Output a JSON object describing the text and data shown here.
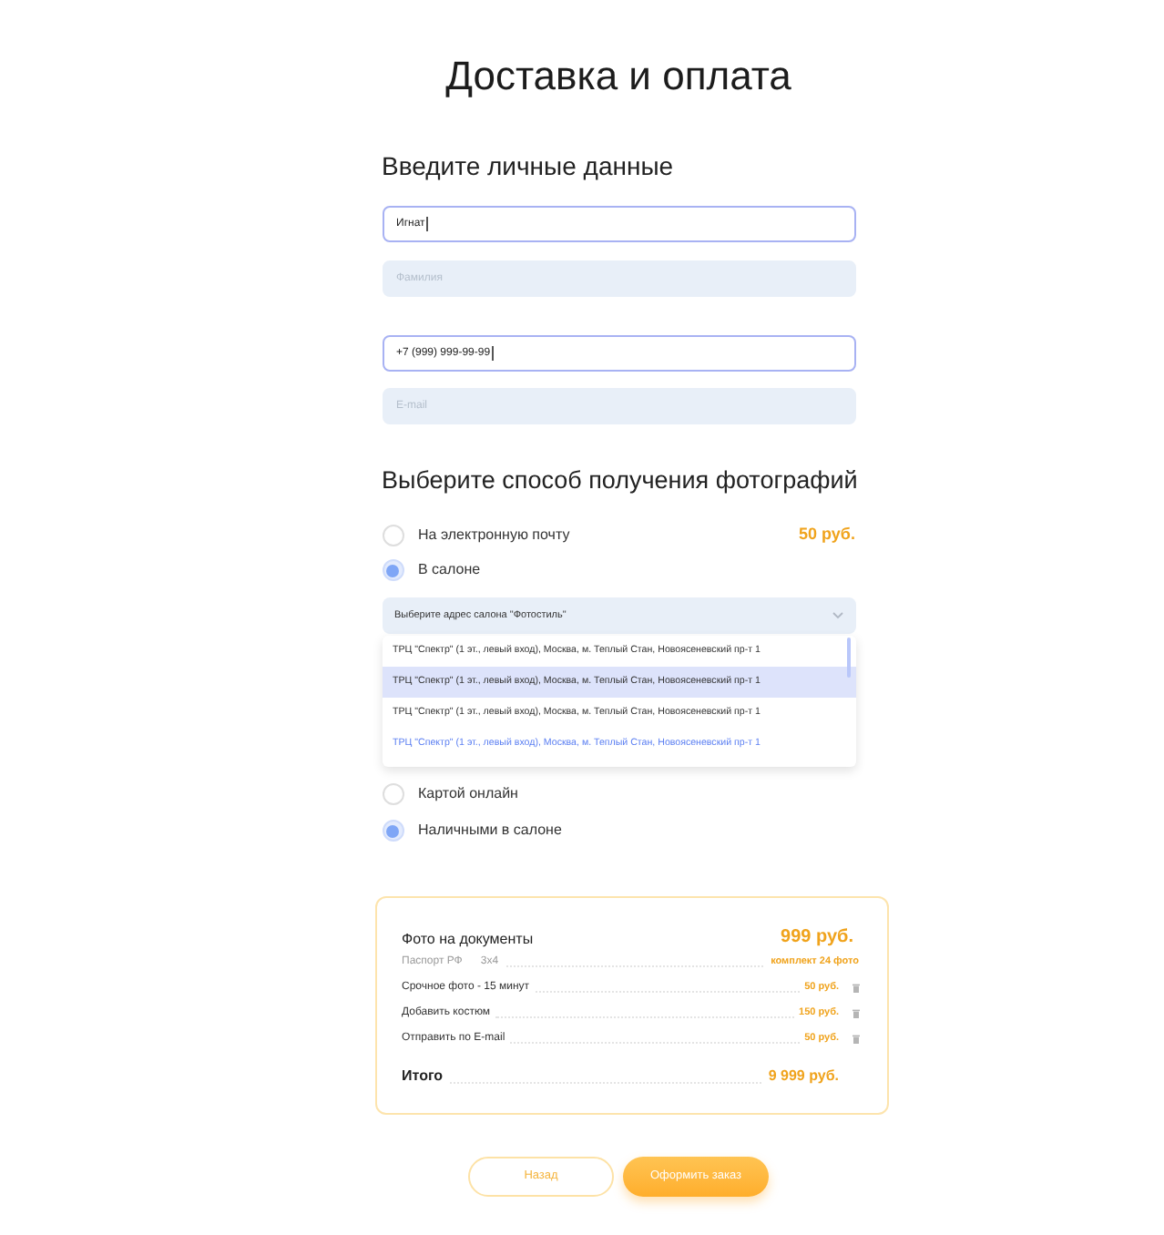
{
  "title": "Доставка и оплата",
  "personal": {
    "heading": "Введите личные данные",
    "name_fields": [
      {
        "value": "Игнат",
        "focused": true
      },
      {
        "placeholder": "Фамилия",
        "focused": false
      }
    ],
    "contact_fields": [
      {
        "value": "+7 (999) 999-99-99",
        "focused": true
      },
      {
        "placeholder": "E-mail",
        "focused": false
      }
    ]
  },
  "delivery": {
    "heading": "Выберите способ получения фотографий",
    "options": [
      {
        "label": "На электронную почту",
        "price": "50 руб.",
        "selected": false
      },
      {
        "label": "В салоне",
        "selected": true
      }
    ],
    "salon_select": {
      "prompt": "Выберите адрес салона \"Фотостиль\"",
      "expanded": true,
      "options": [
        {
          "label": "ТРЦ \"Спектр\" (1 эт., левый вход), Москва, м. Теплый Стан, Новоясеневский пр-т 1",
          "selected": false,
          "hovered": false
        },
        {
          "label": "ТРЦ \"Спектр\" (1 эт., левый вход), Москва, м. Теплый Стан, Новоясеневский пр-т 1",
          "selected": true,
          "hovered": false
        },
        {
          "label": "ТРЦ \"Спектр\" (1 эт., левый вход), Москва, м. Теплый Стан, Новоясеневский пр-т 1",
          "selected": false,
          "hovered": false
        },
        {
          "label": "ТРЦ \"Спектр\" (1 эт., левый вход), Москва, м. Теплый Стан, Новоясеневский пр-т 1",
          "selected": false,
          "hovered": true
        }
      ]
    }
  },
  "payment": {
    "options": [
      {
        "label": "Картой онлайн",
        "selected": false
      },
      {
        "label": "Наличными в салоне",
        "selected": true
      }
    ]
  },
  "summary": {
    "product": {
      "name": "Фото на документы",
      "price": "999 руб.",
      "document": "Паспорт РФ",
      "size": "3х4",
      "package": "комплект 24 фото"
    },
    "extras": [
      {
        "label": "Срочное фото - 15 минут",
        "price": "50 руб."
      },
      {
        "label": "Добавить костюм",
        "price": "150 руб."
      },
      {
        "label": "Отправить по E-mail",
        "price": "50 руб."
      }
    ],
    "total": {
      "label": "Итого",
      "value": "9 999 руб."
    }
  },
  "buttons": [
    {
      "label": "Назад",
      "kind": "secondary"
    },
    {
      "label": "Оформить заказ",
      "kind": "primary"
    }
  ]
}
